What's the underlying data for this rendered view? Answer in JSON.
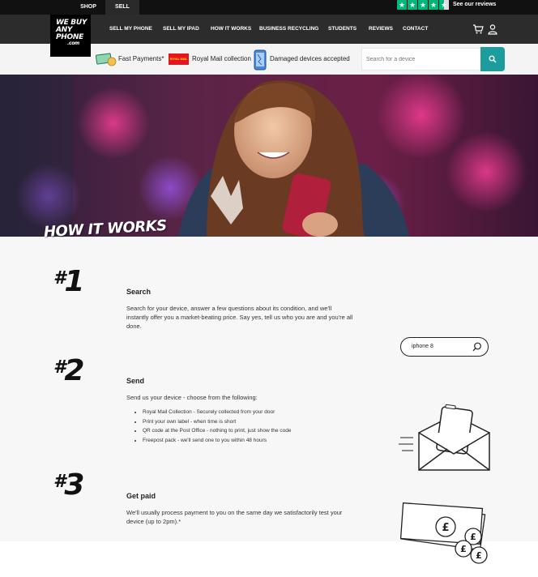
{
  "top_bar": {
    "tabs": [
      "SHOP",
      "SELL"
    ],
    "reviews_label": "See our reviews",
    "rating_stars": 4.5,
    "star_color": "#00b67a"
  },
  "logo": {
    "lines": [
      "WE BUY",
      "ANY",
      "PHONE",
      ".com"
    ]
  },
  "nav": {
    "links": [
      "SELL MY PHONE",
      "SELL MY IPAD",
      "HOW IT WORKS",
      "BUSINESS RECYCLING",
      "STUDENTS",
      "REVIEWS",
      "CONTACT"
    ],
    "icons": [
      "cart-icon",
      "account-icon"
    ]
  },
  "benefits": {
    "items": [
      "Fast Payments*",
      "Royal Mail collection",
      "Damaged devices accepted"
    ],
    "royal_mail_badge": "ROYAL MAIL"
  },
  "search": {
    "placeholder": "Search for a device",
    "button_color": "#1c9c9c"
  },
  "hero": {
    "title": "HOW IT WORKS"
  },
  "steps": [
    {
      "number": "1",
      "title": "Search",
      "text": "Search for your device, answer a few questions about its condition, and we'll instantly offer you a market-beating price. Say yes, tell us who you are and you're all done.",
      "demo_search_value": "iphone 8"
    },
    {
      "number": "2",
      "title": "Send",
      "text": "Send us your device - choose from the following:",
      "options": [
        "Royal Mail Collection - Securely collected from your door",
        "Print your own label - when time is short",
        "QR code at the Post Office - nothing to print, just show the code",
        "Freepost pack - we'll send one to you within 48 hours"
      ]
    },
    {
      "number": "3",
      "title": "Get paid",
      "text": "We'll usually process payment to you on the same day we satisfactorily test your device (up to 2pm).*",
      "currency_symbol": "£"
    }
  ]
}
